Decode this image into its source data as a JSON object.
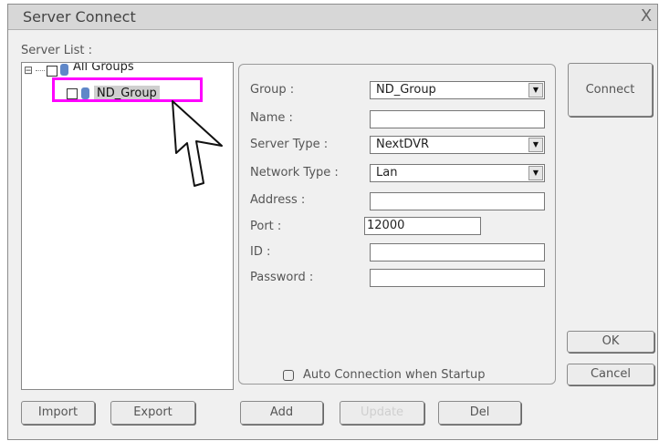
{
  "window": {
    "title": "Server Connect",
    "close_glyph": "X"
  },
  "server_list": {
    "label": "Server List :",
    "tree": [
      {
        "label": "All Groups",
        "expander": "⊟"
      },
      {
        "label": "ND_Group"
      }
    ]
  },
  "form": {
    "group_label": "Group :",
    "group_value": "ND_Group",
    "name_label": "Name :",
    "name_value": "",
    "server_type_label": "Server Type :",
    "server_type_value": "NextDVR",
    "network_type_label": "Network Type :",
    "network_type_value": "Lan",
    "address_label": "Address :",
    "address_value": "",
    "port_label": "Port :",
    "port_value": "12000",
    "id_label": "ID :",
    "id_value": "",
    "password_label": "Password :",
    "password_value": "",
    "auto_connect_label": "Auto Connection when Startup",
    "dropdown_glyph": "▼"
  },
  "buttons": {
    "connect": "Connect",
    "ok": "OK",
    "cancel": "Cancel",
    "import": "Import",
    "export": "Export",
    "add": "Add",
    "update": "Update",
    "del": "Del"
  },
  "colors": {
    "highlight": "#ff00ff",
    "selection_bg": "#cfcfcf",
    "icon_blue": "#5f87c8"
  }
}
